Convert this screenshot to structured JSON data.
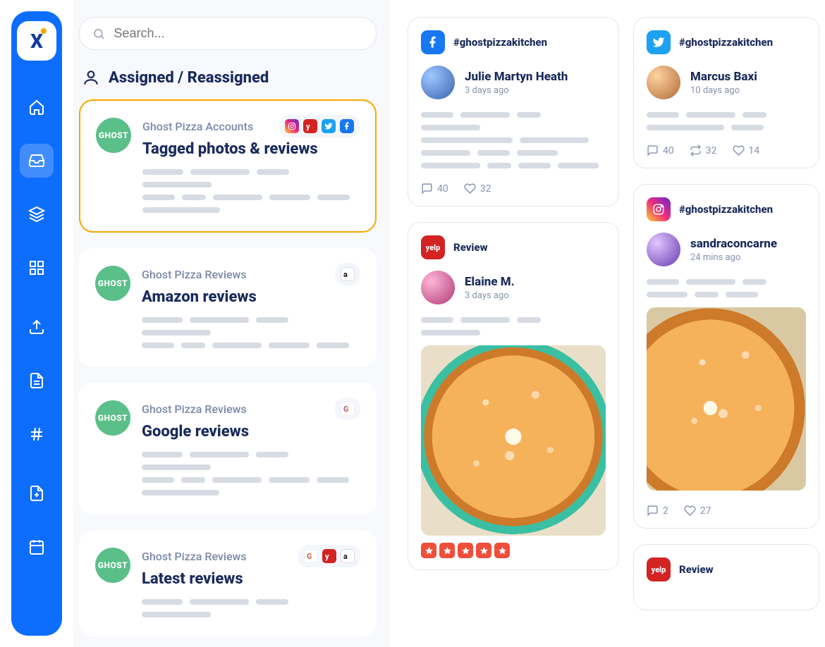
{
  "search": {
    "placeholder": "Search..."
  },
  "section_title": "Assigned / Reassigned",
  "cards": [
    {
      "account": "Ghost Pizza Accounts",
      "title": "Tagged photos & reviews",
      "avatar_text": "GHOST"
    },
    {
      "account": "Ghost Pizza Reviews",
      "title": "Amazon reviews",
      "avatar_text": "GHOST"
    },
    {
      "account": "Ghost Pizza Reviews",
      "title": "Google reviews",
      "avatar_text": "GHOST"
    },
    {
      "account": "Ghost Pizza Reviews",
      "title": "Latest reviews",
      "avatar_text": "GHOST"
    }
  ],
  "posts": {
    "fb": {
      "hashtag": "#ghostpizzakitchen",
      "name": "Julie Martyn Heath",
      "time": "3 days ago",
      "comments": "40",
      "likes": "32"
    },
    "tw": {
      "hashtag": "#ghostpizzakitchen",
      "name": "Marcus Baxi",
      "time": "10 days ago",
      "comments": "40",
      "retweets": "32",
      "likes": "14"
    },
    "yelp1": {
      "label": "Review",
      "name": "Elaine M.",
      "time": "3 days ago"
    },
    "ig": {
      "hashtag": "#ghostpizzakitchen",
      "name": "sandraconcarne",
      "time": "24 mins ago",
      "comments": "2",
      "likes": "27"
    },
    "yelp2": {
      "label": "Review"
    }
  }
}
